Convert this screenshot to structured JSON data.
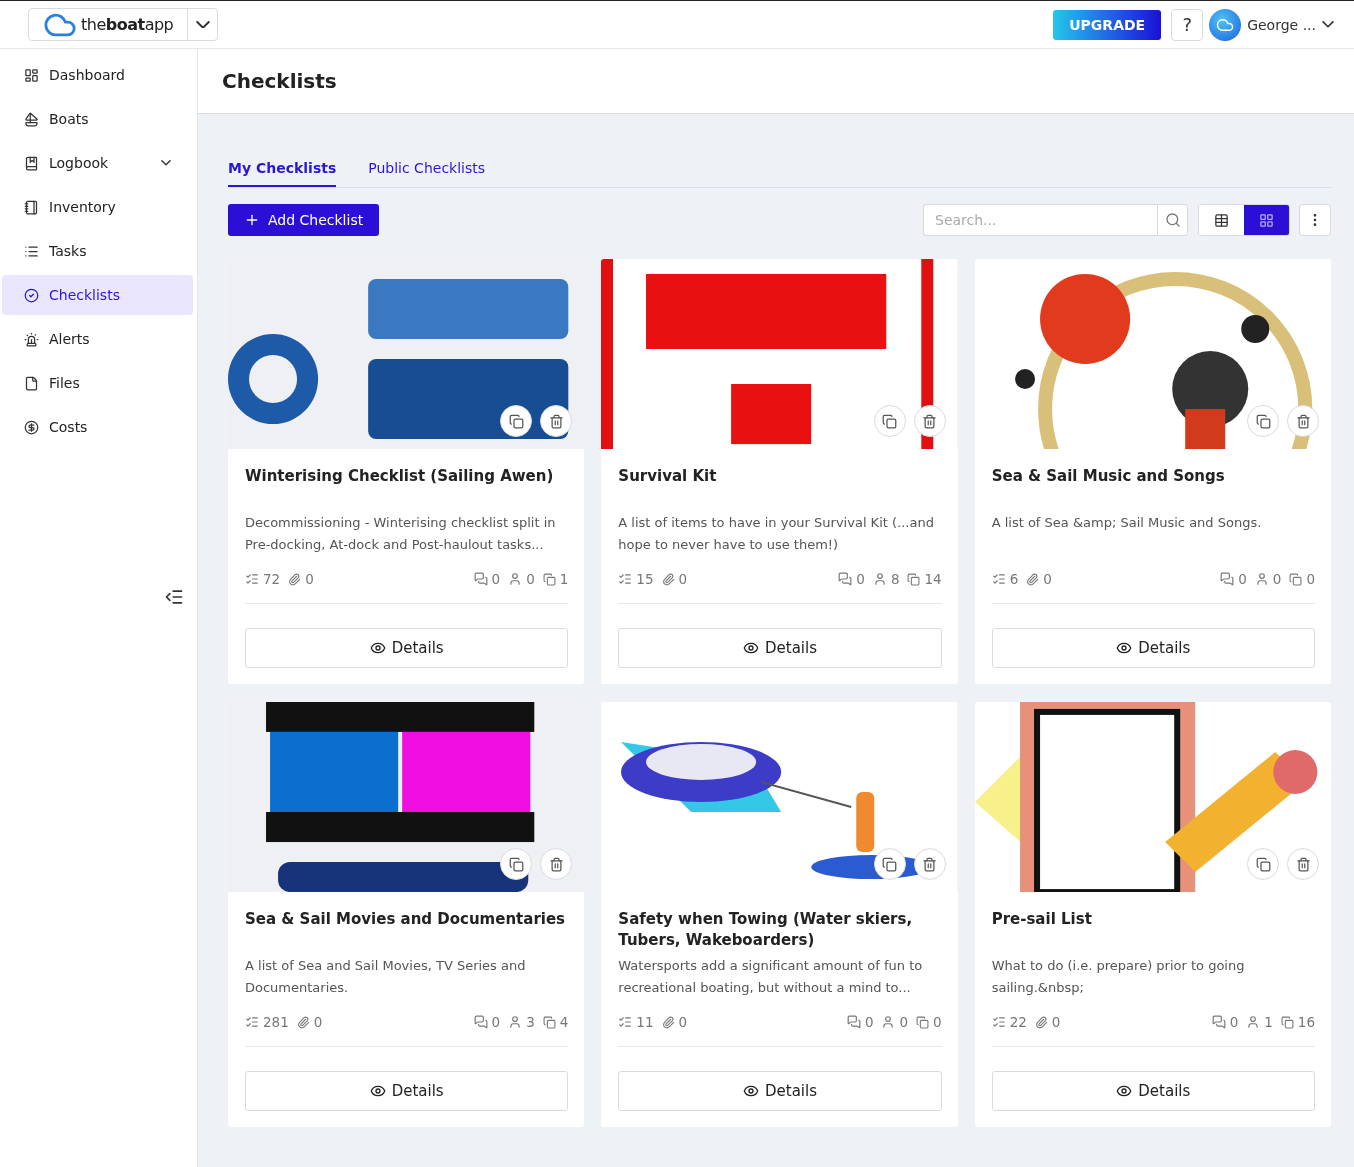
{
  "topbar": {
    "logo": "the**boat**app",
    "upgrade": "UPGRADE",
    "help": "?",
    "user": "George ..."
  },
  "sidebar": {
    "items": [
      {
        "label": "Dashboard",
        "kind": "link",
        "selected": false
      },
      {
        "label": "Boats",
        "kind": "link",
        "selected": false
      },
      {
        "label": "Logbook",
        "kind": "group",
        "selected": false
      },
      {
        "label": "Inventory",
        "kind": "link",
        "selected": false
      },
      {
        "label": "Tasks",
        "kind": "link",
        "selected": false
      },
      {
        "label": "Checklists",
        "kind": "link",
        "selected": true
      },
      {
        "label": "Alerts",
        "kind": "link",
        "selected": false
      },
      {
        "label": "Files",
        "kind": "link",
        "selected": false
      },
      {
        "label": "Costs",
        "kind": "link",
        "selected": false
      }
    ]
  },
  "page": {
    "title": "Checklists"
  },
  "tabs": [
    {
      "label": "My Checklists",
      "selected": true
    },
    {
      "label": "Public Checklists",
      "selected": false
    }
  ],
  "toolbar": {
    "add": "Add Checklist",
    "search": {
      "placeholder": "Search..."
    },
    "views": [
      {
        "kind": "table",
        "selected": false
      },
      {
        "kind": "grid",
        "selected": true
      }
    ]
  },
  "cards": [
    {
      "title": "Winterising Checklist (Sailing Awen)",
      "description": "Decommissioning - Winterising checklist split in Pre-docking, At-dock and Post-haulout tasks...",
      "tasks": "72",
      "attachments": "0",
      "comments": "0",
      "users": "0",
      "copies": "1",
      "action": "Details"
    },
    {
      "title": "Survival Kit",
      "description": "A list of items to have in your Survival Kit (...and hope to never have to use them!)",
      "tasks": "15",
      "attachments": "0",
      "comments": "0",
      "users": "8",
      "copies": "14",
      "action": "Details"
    },
    {
      "title": "Sea & Sail Music and Songs",
      "description": "A list of Sea &amp; Sail Music and Songs.",
      "tasks": "6",
      "attachments": "0",
      "comments": "0",
      "users": "0",
      "copies": "0",
      "action": "Details"
    },
    {
      "title": "Sea & Sail Movies and Documentaries",
      "description": "A list of Sea and Sail Movies, TV Series and Documentaries.",
      "tasks": "281",
      "attachments": "0",
      "comments": "0",
      "users": "3",
      "copies": "4",
      "action": "Details"
    },
    {
      "title": "Safety when Towing (Water skiers, Tubers, Wakeboarders)",
      "description": "Watersports add a significant amount of fun to recreational boating, but without a mind to...",
      "tasks": "11",
      "attachments": "0",
      "comments": "0",
      "users": "0",
      "copies": "0",
      "action": "Details"
    },
    {
      "title": "Pre-sail List",
      "description": "What to do (i.e. prepare) prior to going sailing.&nbsp;",
      "tasks": "22",
      "attachments": "0",
      "comments": "0",
      "users": "1",
      "copies": "16",
      "action": "Details"
    }
  ]
}
